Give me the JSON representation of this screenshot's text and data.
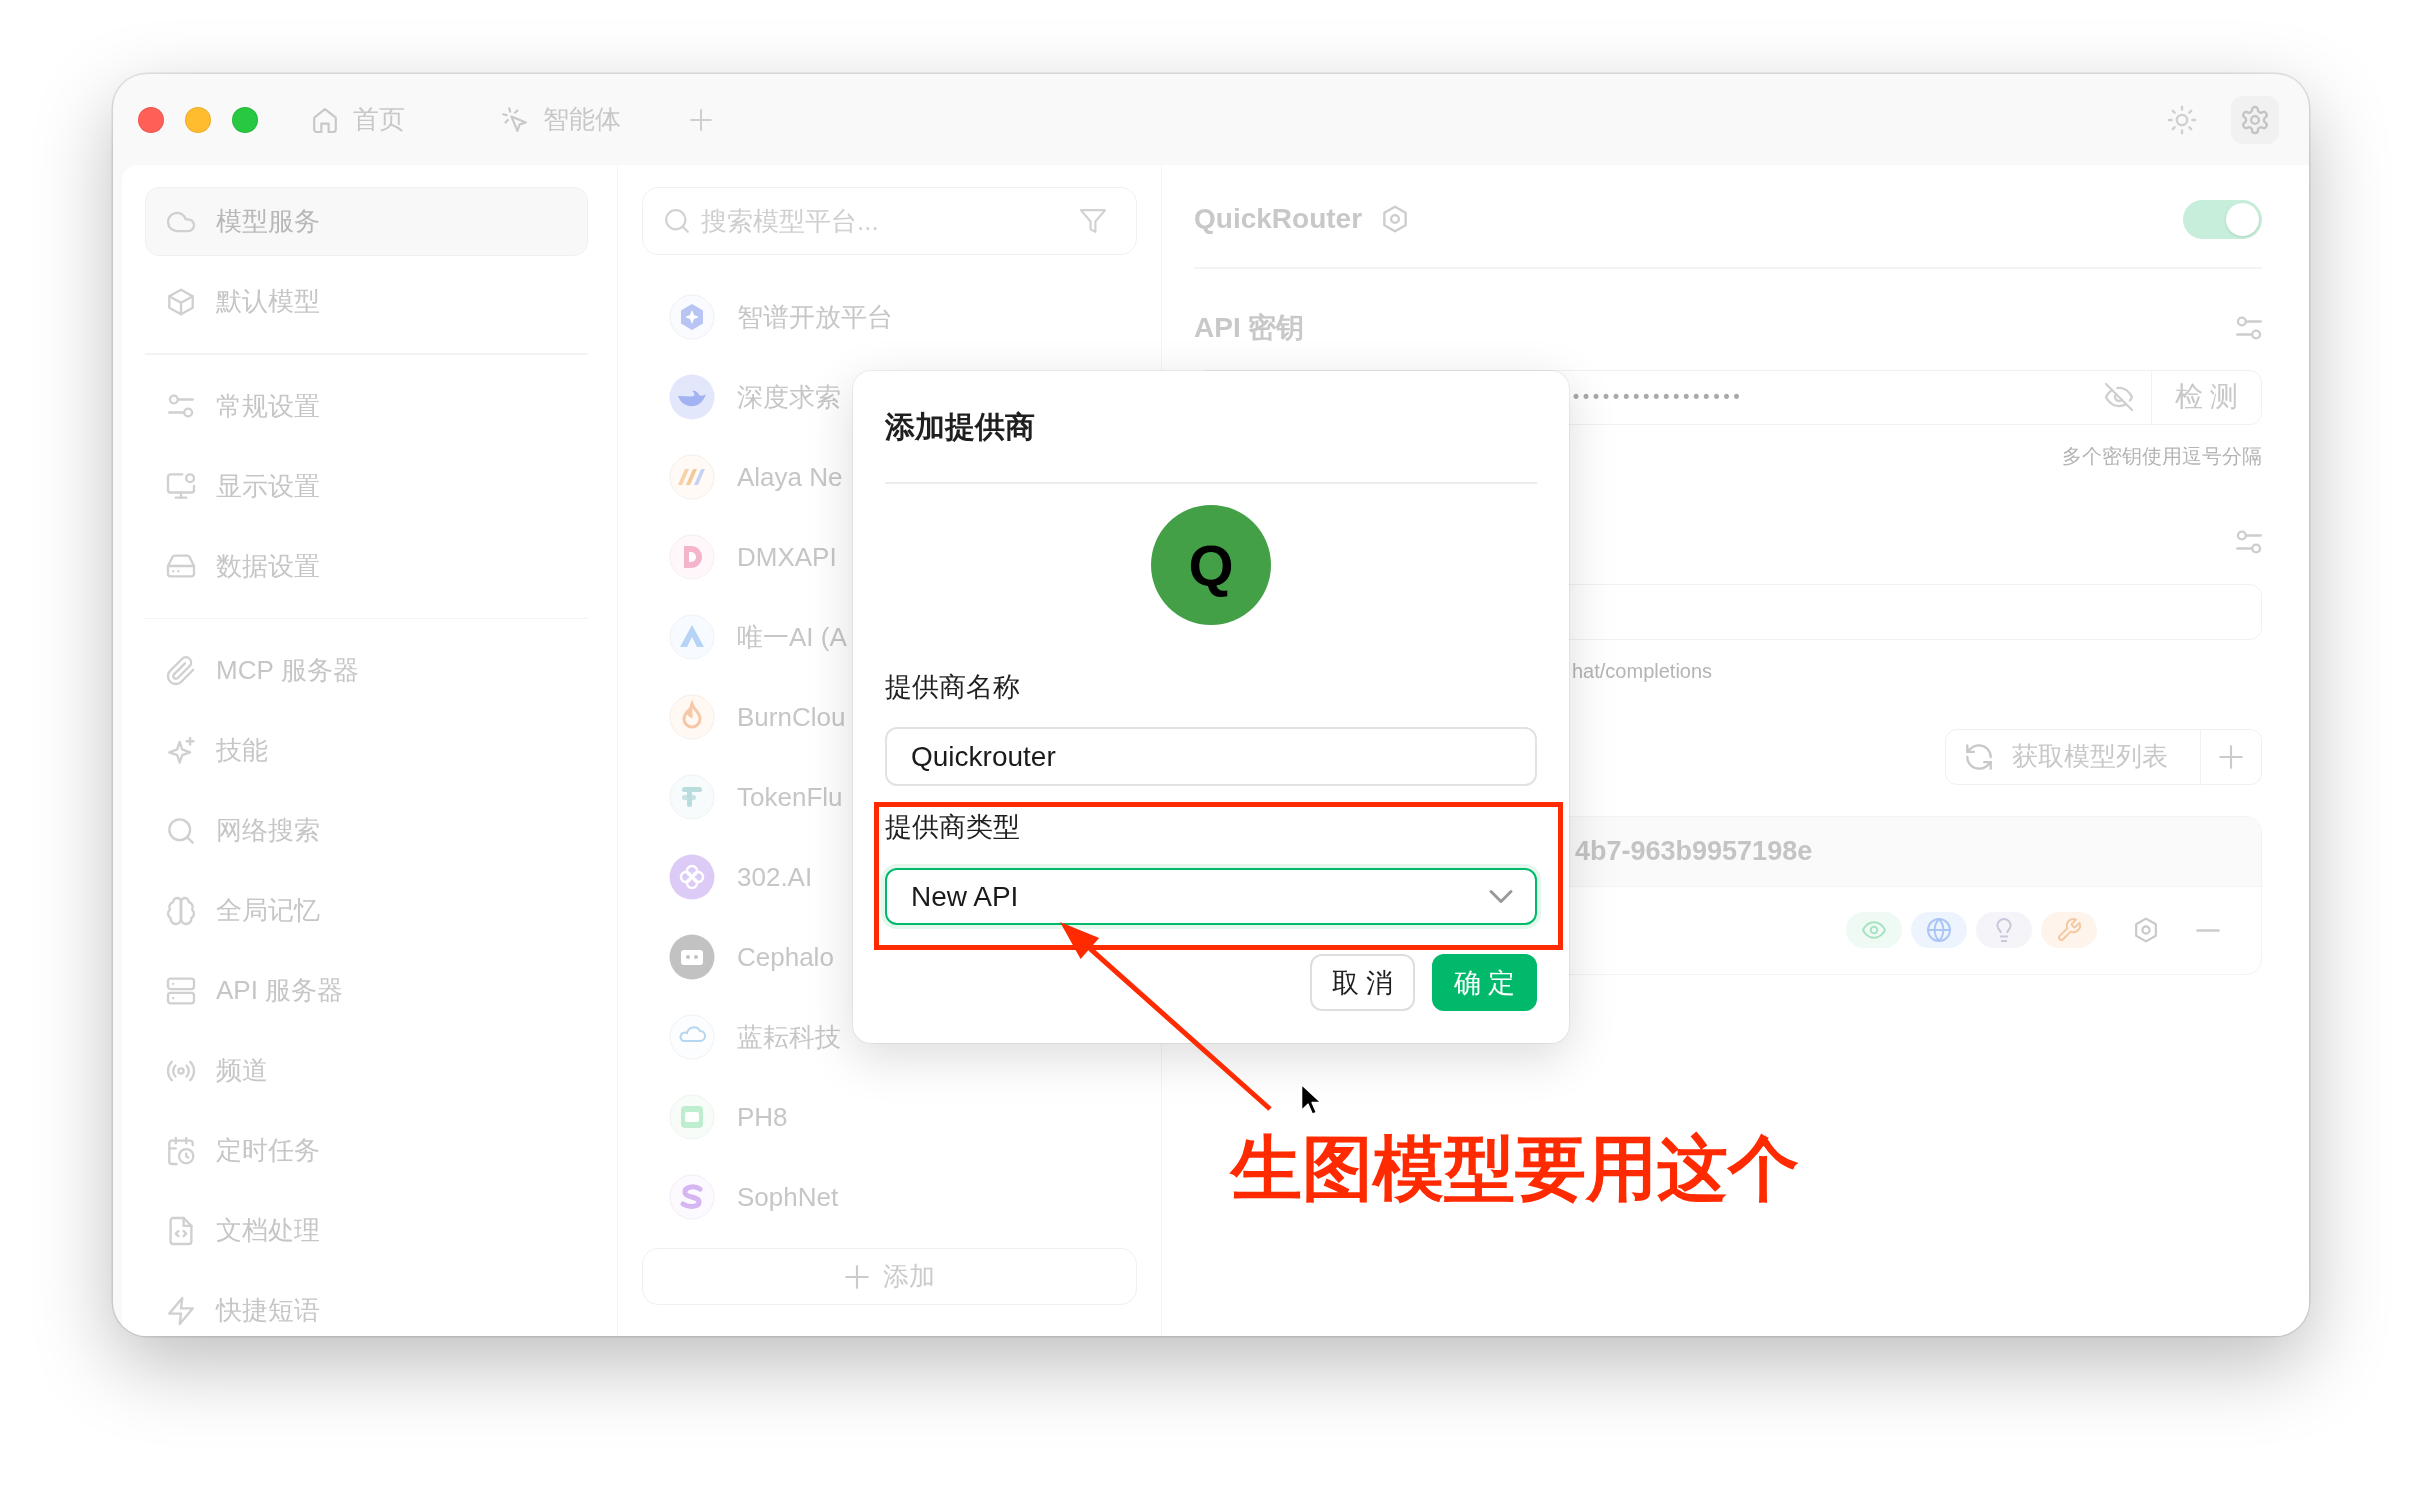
{
  "title_bar": {
    "tabs": [
      {
        "label": "首页",
        "selected": false
      },
      {
        "label": "智能体",
        "selected": false
      }
    ]
  },
  "sidebar": {
    "groups": [
      {
        "items": [
          {
            "label": "模型服务",
            "selected": true
          },
          {
            "label": "默认模型",
            "selected": false
          }
        ]
      },
      {
        "items": [
          {
            "label": "常规设置",
            "selected": false
          },
          {
            "label": "显示设置",
            "selected": false
          },
          {
            "label": "数据设置",
            "selected": false
          }
        ]
      },
      {
        "items": [
          {
            "label": "MCP 服务器",
            "selected": false
          },
          {
            "label": "技能",
            "selected": false
          },
          {
            "label": "网络搜索",
            "selected": false
          },
          {
            "label": "全局记忆",
            "selected": false
          },
          {
            "label": "API 服务器",
            "selected": false
          },
          {
            "label": "频道",
            "selected": false
          },
          {
            "label": "定时任务",
            "selected": false
          },
          {
            "label": "文档处理",
            "selected": false
          },
          {
            "label": "快捷短语",
            "selected": false
          }
        ]
      }
    ]
  },
  "provider_list": {
    "search": {
      "placeholder": "搜索模型平台..."
    },
    "providers": [
      {
        "name": "智谱开放平台"
      },
      {
        "name": "深度求索"
      },
      {
        "name": "Alaya Ne"
      },
      {
        "name": "DMXAPI"
      },
      {
        "name": "唯一AI (A"
      },
      {
        "name": "BurnClou"
      },
      {
        "name": "TokenFlu"
      },
      {
        "name": "302.AI"
      },
      {
        "name": "Cephalo"
      },
      {
        "name": "蓝耘科技"
      },
      {
        "name": "PH8"
      },
      {
        "name": "SophNet"
      }
    ],
    "add_button": "添加"
  },
  "provider_detail": {
    "name": "QuickRouter",
    "enabled": true,
    "api_key": {
      "label": "API 密钥",
      "value": "•••••••••••••••••",
      "check_button": "检 测",
      "hint": "多个密钥使用逗号分隔"
    },
    "api_host": {
      "hint": "hat/completions"
    },
    "models": {
      "fetch_button": "获取模型列表",
      "group": {
        "name": "4b7-963b9957198e"
      }
    }
  },
  "dialog": {
    "title": "添加提供商",
    "avatar": "Q",
    "fields": [
      {
        "kind": "text",
        "label": "提供商名称",
        "value": "Quickrouter",
        "focused": false
      },
      {
        "kind": "select",
        "label": "提供商类型",
        "value": "New API",
        "focused": true
      }
    ],
    "buttons": [
      {
        "kind": "default",
        "label": "取 消"
      },
      {
        "kind": "primary",
        "label": "确 定"
      }
    ]
  },
  "annotation": {
    "text": "生图模型要用这个"
  }
}
